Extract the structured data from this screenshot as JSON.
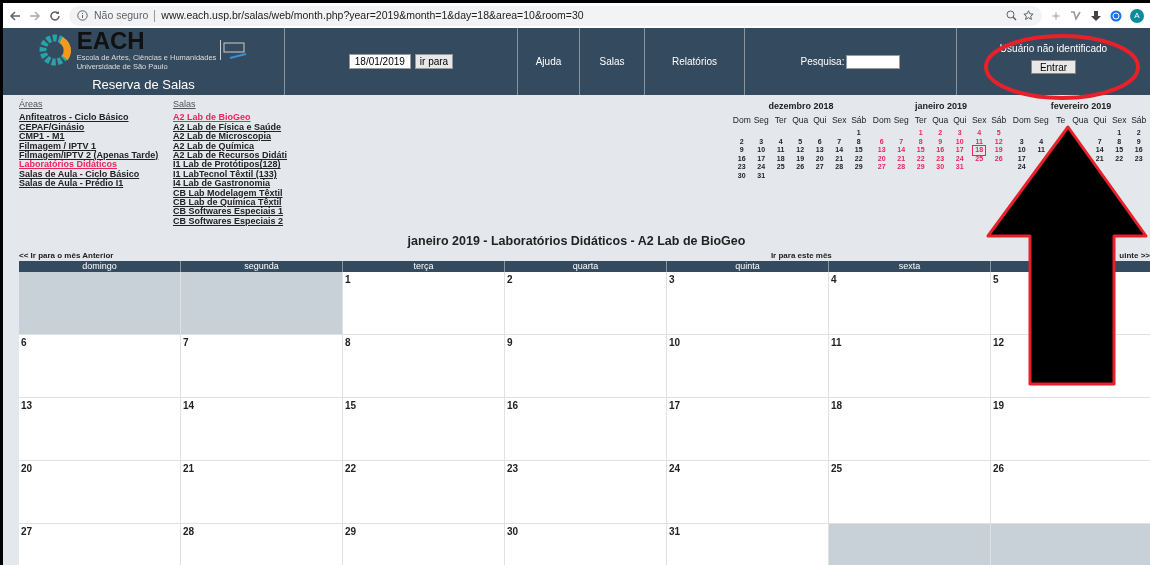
{
  "browser": {
    "security": "Não seguro",
    "url": "www.each.usp.br/salas/web/month.php?year=2019&month=1&day=18&area=10&room=30",
    "avatar": "A"
  },
  "header": {
    "logo_text": "EACH",
    "logo_line_1": "Escola de Artes, Ciências e Humanidades",
    "logo_line_2": "Universidade de São Paulo",
    "app_title": "Reserva de Salas",
    "date_field": {
      "value": "18/01/2019"
    },
    "go_button": "ir para",
    "nav": [
      "Ajuda",
      "Salas",
      "Relatórios"
    ],
    "search": {
      "label": "Pesquisa:"
    },
    "user": {
      "status": "Usuário não identificado",
      "login_button": "Entrar"
    }
  },
  "areas": {
    "heading": "Áreas",
    "items": [
      {
        "label": "Anfiteatros - Ciclo Básico",
        "selected": false
      },
      {
        "label": "CEPAF/Ginásio",
        "selected": false
      },
      {
        "label": "CMP1 - M1",
        "selected": false
      },
      {
        "label": "Filmagem / IPTV 1",
        "selected": false
      },
      {
        "label": "Filmagem/IPTV 2 (Apenas Tarde)",
        "selected": false
      },
      {
        "label": "Laboratórios Didáticos",
        "selected": true
      },
      {
        "label": "Salas de Aula - Ciclo Básico",
        "selected": false
      },
      {
        "label": "Salas de Aula - Prédio I1",
        "selected": false
      }
    ]
  },
  "rooms": {
    "heading": "Salas",
    "items": [
      {
        "label": "A2 Lab de BioGeo",
        "selected": true
      },
      {
        "label": "A2 Lab de Física e Saúde",
        "selected": false
      },
      {
        "label": "A2 Lab de Microscopia",
        "selected": false
      },
      {
        "label": "A2 Lab de Química",
        "selected": false
      },
      {
        "label": "A2 Lab de Recursos Didáti",
        "selected": false
      },
      {
        "label": "I1 Lab de Protótipos(128)",
        "selected": false
      },
      {
        "label": "I1 LabTecnol Têxtil (133)",
        "selected": false
      },
      {
        "label": "I4 Lab de Gastronomia",
        "selected": false
      },
      {
        "label": "CB Lab Modelagem Têxtil",
        "selected": false
      },
      {
        "label": "CB Lab de Química Têxtil",
        "selected": false
      },
      {
        "label": "CB Softwares Especiais 1",
        "selected": false
      },
      {
        "label": "CB Softwares Especiais 2",
        "selected": false
      }
    ]
  },
  "mini_calendars": [
    {
      "title": "dezembro 2018",
      "current": false,
      "weekdays": [
        "Dom",
        "Seg",
        "Ter",
        "Qua",
        "Qui",
        "Sex",
        "Sáb"
      ],
      "weeks": [
        [
          {
            "kind": "blank"
          },
          {
            "kind": "blank"
          },
          {
            "kind": "blank"
          },
          {
            "kind": "blank"
          },
          {
            "kind": "blank"
          },
          {
            "kind": "blank"
          },
          {
            "kind": "day",
            "day": "1",
            "selected": false
          }
        ],
        [
          {
            "kind": "day",
            "day": "2",
            "selected": false
          },
          {
            "kind": "day",
            "day": "3",
            "selected": false
          },
          {
            "kind": "day",
            "day": "4",
            "selected": false
          },
          {
            "kind": "day",
            "day": "5",
            "selected": false
          },
          {
            "kind": "day",
            "day": "6",
            "selected": false
          },
          {
            "kind": "day",
            "day": "7",
            "selected": false
          },
          {
            "kind": "day",
            "day": "8",
            "selected": false
          }
        ],
        [
          {
            "kind": "day",
            "day": "9",
            "selected": false
          },
          {
            "kind": "day",
            "day": "10",
            "selected": false
          },
          {
            "kind": "day",
            "day": "11",
            "selected": false
          },
          {
            "kind": "day",
            "day": "12",
            "selected": false
          },
          {
            "kind": "day",
            "day": "13",
            "selected": false
          },
          {
            "kind": "day",
            "day": "14",
            "selected": false
          },
          {
            "kind": "day",
            "day": "15",
            "selected": false
          }
        ],
        [
          {
            "kind": "day",
            "day": "16",
            "selected": false
          },
          {
            "kind": "day",
            "day": "17",
            "selected": false
          },
          {
            "kind": "day",
            "day": "18",
            "selected": false
          },
          {
            "kind": "day",
            "day": "19",
            "selected": false
          },
          {
            "kind": "day",
            "day": "20",
            "selected": false
          },
          {
            "kind": "day",
            "day": "21",
            "selected": false
          },
          {
            "kind": "day",
            "day": "22",
            "selected": false
          }
        ],
        [
          {
            "kind": "day",
            "day": "23",
            "selected": false
          },
          {
            "kind": "day",
            "day": "24",
            "selected": false
          },
          {
            "kind": "day",
            "day": "25",
            "selected": false
          },
          {
            "kind": "day",
            "day": "26",
            "selected": false
          },
          {
            "kind": "day",
            "day": "27",
            "selected": false
          },
          {
            "kind": "day",
            "day": "28",
            "selected": false
          },
          {
            "kind": "day",
            "day": "29",
            "selected": false
          }
        ],
        [
          {
            "kind": "day",
            "day": "30",
            "selected": false
          },
          {
            "kind": "day",
            "day": "31",
            "selected": false
          }
        ]
      ]
    },
    {
      "title": "janeiro 2019",
      "current": true,
      "weekdays": [
        "Dom",
        "Seg",
        "Ter",
        "Qua",
        "Qui",
        "Sex",
        "Sáb"
      ],
      "weeks": [
        [
          {
            "kind": "blank"
          },
          {
            "kind": "blank"
          },
          {
            "kind": "day",
            "day": "1",
            "selected": false
          },
          {
            "kind": "day",
            "day": "2",
            "selected": false
          },
          {
            "kind": "day",
            "day": "3",
            "selected": false
          },
          {
            "kind": "day",
            "day": "4",
            "selected": false
          },
          {
            "kind": "day",
            "day": "5",
            "selected": false
          }
        ],
        [
          {
            "kind": "day",
            "day": "6",
            "selected": false
          },
          {
            "kind": "day",
            "day": "7",
            "selected": false
          },
          {
            "kind": "day",
            "day": "8",
            "selected": false
          },
          {
            "kind": "day",
            "day": "9",
            "selected": false
          },
          {
            "kind": "day",
            "day": "10",
            "selected": false
          },
          {
            "kind": "day",
            "day": "11",
            "selected": false
          },
          {
            "kind": "day",
            "day": "12",
            "selected": false
          }
        ],
        [
          {
            "kind": "day",
            "day": "13",
            "selected": false
          },
          {
            "kind": "day",
            "day": "14",
            "selected": false
          },
          {
            "kind": "day",
            "day": "15",
            "selected": false
          },
          {
            "kind": "day",
            "day": "16",
            "selected": false
          },
          {
            "kind": "day",
            "day": "17",
            "selected": false
          },
          {
            "kind": "day",
            "day": "18",
            "selected": true
          },
          {
            "kind": "day",
            "day": "19",
            "selected": false
          }
        ],
        [
          {
            "kind": "day",
            "day": "20",
            "selected": false
          },
          {
            "kind": "day",
            "day": "21",
            "selected": false
          },
          {
            "kind": "day",
            "day": "22",
            "selected": false
          },
          {
            "kind": "day",
            "day": "23",
            "selected": false
          },
          {
            "kind": "day",
            "day": "24",
            "selected": false
          },
          {
            "kind": "day",
            "day": "25",
            "selected": false
          },
          {
            "kind": "day",
            "day": "26",
            "selected": false
          }
        ],
        [
          {
            "kind": "day",
            "day": "27",
            "selected": false
          },
          {
            "kind": "day",
            "day": "28",
            "selected": false
          },
          {
            "kind": "day",
            "day": "29",
            "selected": false
          },
          {
            "kind": "day",
            "day": "30",
            "selected": false
          },
          {
            "kind": "day",
            "day": "31",
            "selected": false
          }
        ]
      ]
    },
    {
      "title": "fevereiro 2019",
      "current": false,
      "weekdays": [
        "Dom",
        "Seg",
        "Te",
        "Qua",
        "Qui",
        "Sex",
        "Sáb"
      ],
      "weeks": [
        [
          {
            "kind": "blank"
          },
          {
            "kind": "blank"
          },
          {
            "kind": "blank"
          },
          {
            "kind": "blank"
          },
          {
            "kind": "blank"
          },
          {
            "kind": "day",
            "day": "1",
            "selected": false
          },
          {
            "kind": "day",
            "day": "2",
            "selected": false
          }
        ],
        [
          {
            "kind": "day",
            "day": "3",
            "selected": false
          },
          {
            "kind": "day",
            "day": "4",
            "selected": false
          },
          {
            "kind": "blank"
          },
          {
            "kind": "blank"
          },
          {
            "kind": "day",
            "day": "7",
            "selected": false
          },
          {
            "kind": "day",
            "day": "8",
            "selected": false
          },
          {
            "kind": "day",
            "day": "9",
            "selected": false
          }
        ],
        [
          {
            "kind": "day",
            "day": "10",
            "selected": false
          },
          {
            "kind": "day",
            "day": "11",
            "selected": false
          },
          {
            "kind": "blank"
          },
          {
            "kind": "blank"
          },
          {
            "kind": "day",
            "day": "14",
            "selected": false
          },
          {
            "kind": "day",
            "day": "15",
            "selected": false
          },
          {
            "kind": "day",
            "day": "16",
            "selected": false
          }
        ],
        [
          {
            "kind": "day",
            "day": "17",
            "selected": false
          },
          {
            "kind": "blank"
          },
          {
            "kind": "blank"
          },
          {
            "kind": "blank"
          },
          {
            "kind": "day",
            "day": "21",
            "selected": false
          },
          {
            "kind": "day",
            "day": "22",
            "selected": false
          },
          {
            "kind": "day",
            "day": "23",
            "selected": false
          }
        ],
        [
          {
            "kind": "day",
            "day": "24",
            "selected": false
          }
        ]
      ]
    }
  ],
  "month_view": {
    "title": "janeiro 2019 - Laboratórios Didáticos - A2 Lab de BioGeo",
    "prev_link": "<< Ir para o mês Anterior",
    "this_link": "Ir para este mês",
    "next_link": "uinte >>",
    "columns": [
      "domingo",
      "segunda",
      "terça",
      "quarta",
      "quinta",
      "sexta"
    ],
    "weeks": [
      [
        {
          "kind": "blank"
        },
        {
          "kind": "blank"
        },
        {
          "kind": "day",
          "day": "1"
        },
        {
          "kind": "day",
          "day": "2"
        },
        {
          "kind": "day",
          "day": "3"
        },
        {
          "kind": "day",
          "day": "4"
        },
        {
          "kind": "day",
          "day": "5"
        }
      ],
      [
        {
          "kind": "day",
          "day": "6"
        },
        {
          "kind": "day",
          "day": "7"
        },
        {
          "kind": "day",
          "day": "8"
        },
        {
          "kind": "day",
          "day": "9"
        },
        {
          "kind": "day",
          "day": "10"
        },
        {
          "kind": "day",
          "day": "11"
        },
        {
          "kind": "day",
          "day": "12"
        }
      ],
      [
        {
          "kind": "day",
          "day": "13"
        },
        {
          "kind": "day",
          "day": "14"
        },
        {
          "kind": "day",
          "day": "15"
        },
        {
          "kind": "day",
          "day": "16"
        },
        {
          "kind": "day",
          "day": "17"
        },
        {
          "kind": "day",
          "day": "18"
        },
        {
          "kind": "day",
          "day": "19"
        }
      ],
      [
        {
          "kind": "day",
          "day": "20"
        },
        {
          "kind": "day",
          "day": "21"
        },
        {
          "kind": "day",
          "day": "22"
        },
        {
          "kind": "day",
          "day": "23"
        },
        {
          "kind": "day",
          "day": "24"
        },
        {
          "kind": "day",
          "day": "25"
        },
        {
          "kind": "day",
          "day": "26"
        }
      ],
      [
        {
          "kind": "day",
          "day": "27"
        },
        {
          "kind": "day",
          "day": "28"
        },
        {
          "kind": "day",
          "day": "29"
        },
        {
          "kind": "day",
          "day": "30"
        },
        {
          "kind": "day",
          "day": "31"
        },
        {
          "kind": "blank"
        },
        {
          "kind": "blank"
        }
      ]
    ]
  }
}
